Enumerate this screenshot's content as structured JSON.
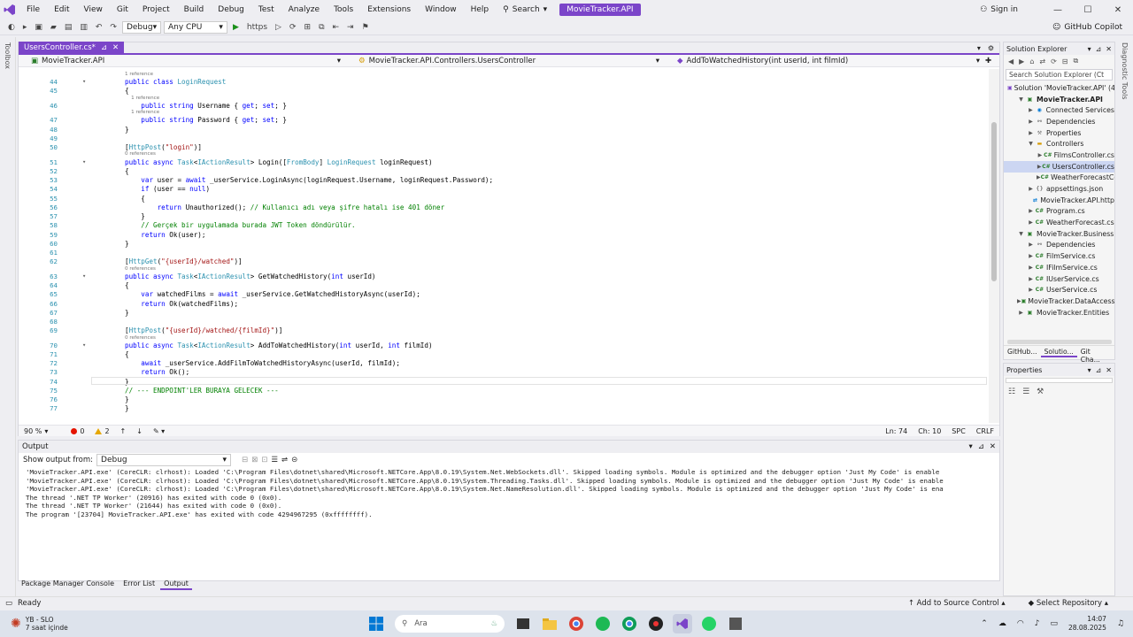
{
  "menubar": {
    "items": [
      "File",
      "Edit",
      "View",
      "Git",
      "Project",
      "Build",
      "Debug",
      "Test",
      "Analyze",
      "Tools",
      "Extensions",
      "Window",
      "Help"
    ],
    "search_label": "Search",
    "project_name": "MovieTracker.API",
    "signin_label": "Sign in"
  },
  "toolbar": {
    "config": "Debug",
    "platform": "Any CPU",
    "run_target": "https",
    "copilot_label": "GitHub Copilot"
  },
  "side_labels": {
    "toolbox": "Toolbox",
    "diagnostics": "Diagnostic Tools"
  },
  "editor": {
    "tab_label": "UsersController.cs*",
    "nav_project": "MovieTracker.API",
    "nav_class": "MovieTracker.API.Controllers.UsersController",
    "nav_member": "AddToWatchedHistory(int userId, int filmId)",
    "lines": [
      {
        "n": "",
        "ref": "1 reference"
      },
      {
        "n": "44",
        "html": "<span class='kw'>public class</span> <span class='ty'>LoginRequest</span>"
      },
      {
        "n": "45",
        "html": "{"
      },
      {
        "n": "",
        "ref": "    1 reference"
      },
      {
        "n": "46",
        "html": "    <span class='kw'>public string</span> Username { <span class='kw'>get</span>; <span class='kw'>set</span>; }"
      },
      {
        "n": "",
        "ref": "    1 reference"
      },
      {
        "n": "47",
        "html": "    <span class='kw'>public string</span> Password { <span class='kw'>get</span>; <span class='kw'>set</span>; }"
      },
      {
        "n": "48",
        "html": "}"
      },
      {
        "n": "49",
        "html": ""
      },
      {
        "n": "50",
        "html": "[<span class='ty'>HttpPost</span>(<span class='st'>\"login\"</span>)]"
      },
      {
        "n": "",
        "ref": "0 references"
      },
      {
        "n": "51",
        "html": "<span class='kw'>public async</span> <span class='ty'>Task</span>&lt;<span class='ty'>IActionResult</span>&gt; Login([<span class='ty'>FromBody</span>] <span class='ty'>LoginRequest</span> loginRequest)"
      },
      {
        "n": "52",
        "html": "{"
      },
      {
        "n": "53",
        "html": "    <span class='kw'>var</span> user = <span class='kw'>await</span> _userService.LoginAsync(loginRequest.Username, loginRequest.Password);"
      },
      {
        "n": "54",
        "html": "    <span class='kw'>if</span> (user == <span class='kw'>null</span>)"
      },
      {
        "n": "55",
        "html": "    {"
      },
      {
        "n": "56",
        "html": "        <span class='kw'>return</span> Unauthorized(); <span class='cm'>// Kullanıcı adı veya şifre hatalı ise 401 döner</span>"
      },
      {
        "n": "57",
        "html": "    }"
      },
      {
        "n": "58",
        "html": "    <span class='cm'>// Gerçek bir uygulamada burada JWT Token döndürülür.</span>"
      },
      {
        "n": "59",
        "html": "    <span class='kw'>return</span> Ok(user);"
      },
      {
        "n": "60",
        "html": "}"
      },
      {
        "n": "61",
        "html": ""
      },
      {
        "n": "62",
        "html": "[<span class='ty'>HttpGet</span>(<span class='st'>\"{userId}/watched\"</span>)]"
      },
      {
        "n": "",
        "ref": "0 references"
      },
      {
        "n": "63",
        "html": "<span class='kw'>public async</span> <span class='ty'>Task</span>&lt;<span class='ty'>IActionResult</span>&gt; GetWatchedHistory(<span class='kw'>int</span> userId)"
      },
      {
        "n": "64",
        "html": "{"
      },
      {
        "n": "65",
        "html": "    <span class='kw'>var</span> watchedFilms = <span class='kw'>await</span> _userService.GetWatchedHistoryAsync(userId);"
      },
      {
        "n": "66",
        "html": "    <span class='kw'>return</span> Ok(watchedFilms);"
      },
      {
        "n": "67",
        "html": "}"
      },
      {
        "n": "68",
        "html": ""
      },
      {
        "n": "69",
        "html": "[<span class='ty'>HttpPost</span>(<span class='st'>\"{userId}/watched/{filmId}\"</span>)]"
      },
      {
        "n": "",
        "ref": "0 references"
      },
      {
        "n": "70",
        "html": "<span class='kw'>public async</span> <span class='ty'>Task</span>&lt;<span class='ty'>IActionResult</span>&gt; AddToWatchedHistory(<span class='kw'>int</span> userId, <span class='kw'>int</span> filmId)"
      },
      {
        "n": "71",
        "html": "{"
      },
      {
        "n": "72",
        "html": "    <span class='kw'>await</span> _userService.AddFilmToWatchedHistoryAsync(userId, filmId);"
      },
      {
        "n": "73",
        "html": "    <span class='kw'>return</span> Ok();"
      },
      {
        "n": "74",
        "html": "}"
      },
      {
        "n": "75",
        "html": "<span class='cm'>// --- ENDPOINT'LER BURAYA GELECEK ---</span>"
      },
      {
        "n": "76",
        "html": "}"
      },
      {
        "n": "77",
        "html": "}"
      }
    ],
    "status": {
      "zoom": "90 %",
      "errors": "0",
      "warnings": "2",
      "line": "Ln: 74",
      "col": "Ch: 10",
      "spacing": "SPC",
      "eol": "CRLF"
    }
  },
  "solution_explorer": {
    "title": "Solution Explorer",
    "search_placeholder": "Search Solution Explorer (Ct",
    "nodes": [
      {
        "label": "Solution 'MovieTracker.API' (4",
        "indent": 0,
        "arrow": "",
        "icon": "sln"
      },
      {
        "label": "MovieTracker.API",
        "indent": 1,
        "arrow": "▼",
        "icon": "proj",
        "bold": true
      },
      {
        "label": "Connected Services",
        "indent": 2,
        "arrow": "▶",
        "icon": "svc"
      },
      {
        "label": "Dependencies",
        "indent": 2,
        "arrow": "▶",
        "icon": "dep"
      },
      {
        "label": "Properties",
        "indent": 2,
        "arrow": "▶",
        "icon": "prop"
      },
      {
        "label": "Controllers",
        "indent": 2,
        "arrow": "▼",
        "icon": "folder"
      },
      {
        "label": "FilmsController.cs",
        "indent": 3,
        "arrow": "▶",
        "icon": "cs"
      },
      {
        "label": "UsersController.cs",
        "indent": 3,
        "arrow": "▶",
        "icon": "cs",
        "selected": true
      },
      {
        "label": "WeatherForecastCo",
        "indent": 3,
        "arrow": "▶",
        "icon": "cs"
      },
      {
        "label": "appsettings.json",
        "indent": 2,
        "arrow": "▶",
        "icon": "json"
      },
      {
        "label": "MovieTracker.API.http",
        "indent": 2,
        "arrow": "",
        "icon": "http"
      },
      {
        "label": "Program.cs",
        "indent": 2,
        "arrow": "▶",
        "icon": "cs"
      },
      {
        "label": "WeatherForecast.cs",
        "indent": 2,
        "arrow": "▶",
        "icon": "cs"
      },
      {
        "label": "MovieTracker.Business",
        "indent": 1,
        "arrow": "▼",
        "icon": "proj"
      },
      {
        "label": "Dependencies",
        "indent": 2,
        "arrow": "▶",
        "icon": "dep"
      },
      {
        "label": "FilmService.cs",
        "indent": 2,
        "arrow": "▶",
        "icon": "cs"
      },
      {
        "label": "IFilmService.cs",
        "indent": 2,
        "arrow": "▶",
        "icon": "cs"
      },
      {
        "label": "IUserService.cs",
        "indent": 2,
        "arrow": "▶",
        "icon": "cs"
      },
      {
        "label": "UserService.cs",
        "indent": 2,
        "arrow": "▶",
        "icon": "cs"
      },
      {
        "label": "MovieTracker.DataAccess",
        "indent": 1,
        "arrow": "▶",
        "icon": "proj"
      },
      {
        "label": "MovieTracker.Entities",
        "indent": 1,
        "arrow": "▶",
        "icon": "proj"
      }
    ],
    "bottom_tabs": [
      "GitHub...",
      "Solutio...",
      "Git Cha..."
    ]
  },
  "properties": {
    "title": "Properties"
  },
  "output": {
    "title": "Output",
    "show_from_label": "Show output from:",
    "source": "Debug",
    "lines": [
      "'MovieTracker.API.exe' (CoreCLR: clrhost): Loaded 'C:\\Program Files\\dotnet\\shared\\Microsoft.NETCore.App\\8.0.19\\System.Net.WebSockets.dll'. Skipped loading symbols. Module is optimized and the debugger option 'Just My Code' is enable",
      "'MovieTracker.API.exe' (CoreCLR: clrhost): Loaded 'C:\\Program Files\\dotnet\\shared\\Microsoft.NETCore.App\\8.0.19\\System.Threading.Tasks.dll'. Skipped loading symbols. Module is optimized and the debugger option 'Just My Code' is enable",
      "'MovieTracker.API.exe' (CoreCLR: clrhost): Loaded 'C:\\Program Files\\dotnet\\shared\\Microsoft.NETCore.App\\8.0.19\\System.Net.NameResolution.dll'. Skipped loading symbols. Module is optimized and the debugger option 'Just My Code' is ena",
      "The thread '.NET TP Worker' (20916) has exited with code 0 (0x0).",
      "The thread '.NET TP Worker' (21644) has exited with code 0 (0x0).",
      "The program '[23704] MovieTracker.API.exe' has exited with code 4294967295 (0xffffffff)."
    ]
  },
  "bottom_tabs": [
    "Package Manager Console",
    "Error List",
    "Output"
  ],
  "statusbar": {
    "left": "Ready",
    "source_control": "Add to Source Control",
    "repo": "Select Repository"
  },
  "taskbar": {
    "weather_temp": "YB - SLO",
    "weather_sub": "7 saat içinde",
    "search_placeholder": "Ara",
    "time": "14:07",
    "date": "28.08.2025"
  },
  "colors": {
    "accent": "#7b45c9",
    "keyword": "#0000ff",
    "type": "#2b91af",
    "string": "#a31515",
    "comment": "#008000"
  }
}
